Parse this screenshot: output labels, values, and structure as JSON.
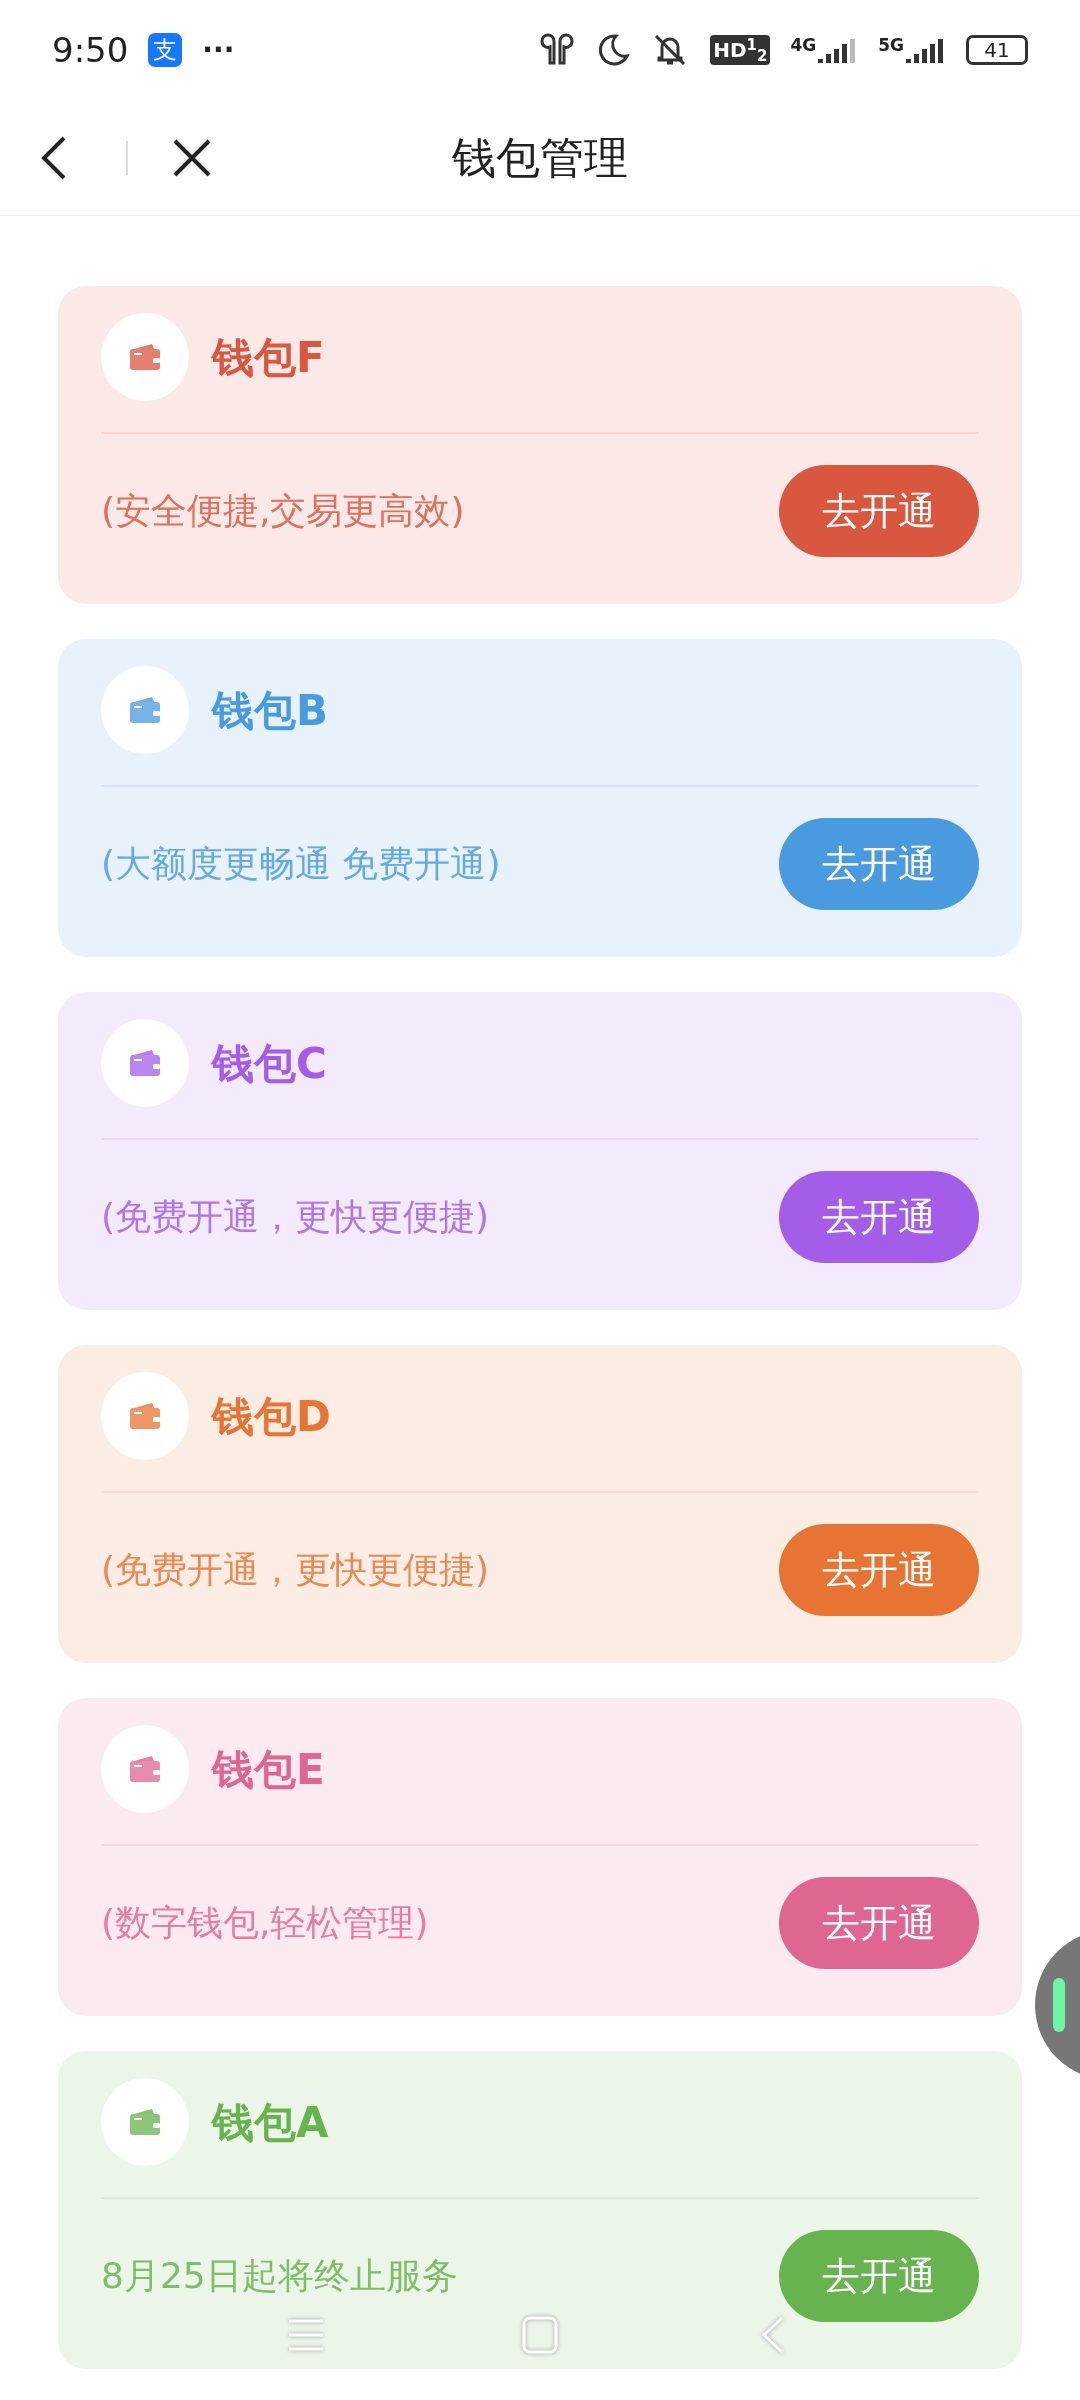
{
  "status_bar": {
    "time": "9:50",
    "app_badge": "支",
    "more": "···",
    "hd": "HD$^{1}$$_{2}$",
    "network_1": "4G",
    "network_2": "5G",
    "battery": "41"
  },
  "header": {
    "title": "钱包管理"
  },
  "wallets": [
    {
      "name": "钱包F",
      "description": "(安全便捷,交易更高效)",
      "button": "去开通",
      "color": "#d9573f"
    },
    {
      "name": "钱包B",
      "description": "(大额度更畅通 免费开通)",
      "button": "去开通",
      "color": "#4a9ae0"
    },
    {
      "name": "钱包C",
      "description": "(免费开通，更快更便捷)",
      "button": "去开通",
      "color": "#a35de8"
    },
    {
      "name": "钱包D",
      "description": "(免费开通，更快更便捷)",
      "button": "去开通",
      "color": "#e87433"
    },
    {
      "name": "钱包E",
      "description": "(数字钱包,轻松管理)",
      "button": "去开通",
      "color": "#df6690"
    },
    {
      "name": "钱包A",
      "description": "8月25日起将终止服务",
      "button": "去开通",
      "color": "#67b34e"
    }
  ]
}
